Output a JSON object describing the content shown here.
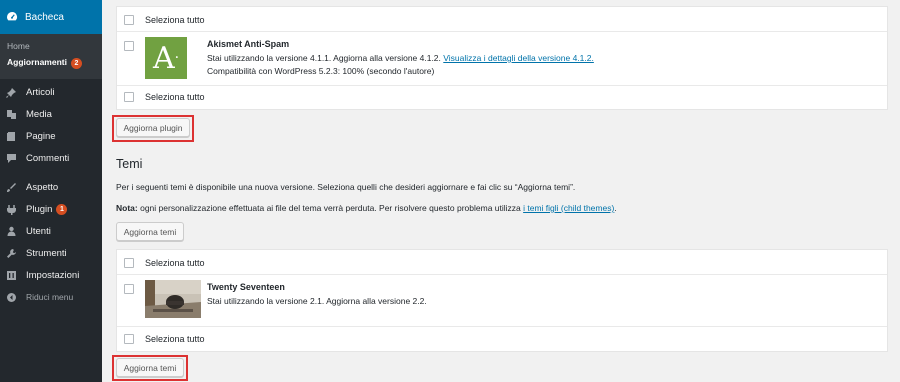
{
  "sidebar": {
    "dashboard": "Bacheca",
    "sub": {
      "home": "Home",
      "updates": "Aggiornamenti",
      "updates_count": "2"
    },
    "items": [
      {
        "label": "Articoli",
        "icon": "pin-icon"
      },
      {
        "label": "Media",
        "icon": "media-icon"
      },
      {
        "label": "Pagine",
        "icon": "pages-icon"
      },
      {
        "label": "Commenti",
        "icon": "comments-icon"
      },
      {
        "label": "Aspetto",
        "icon": "appearance-icon"
      },
      {
        "label": "Plugin",
        "icon": "plugin-icon",
        "badge": "1"
      },
      {
        "label": "Utenti",
        "icon": "users-icon"
      },
      {
        "label": "Strumenti",
        "icon": "tools-icon"
      },
      {
        "label": "Impostazioni",
        "icon": "settings-icon"
      }
    ],
    "collapse": "Riduci menu"
  },
  "plugins": {
    "select_all_top": "Seleziona tutto",
    "select_all_bottom": "Seleziona tutto",
    "item": {
      "name": "Akismet Anti-Spam",
      "desc": "Stai utilizzando la versione 4.1.1. Aggiorna alla versione 4.1.2.",
      "link": "Visualizza i dettagli della versione 4.1.2.",
      "compat": "Compatibilità con WordPress 5.2.3: 100% (secondo l'autore)"
    },
    "button": "Aggiorna plugin"
  },
  "themes": {
    "heading": "Temi",
    "intro": "Per i seguenti temi è disponibile una nuova versione. Seleziona quelli che desideri aggiornare e fai clic su “Aggiorna temi”.",
    "note_label": "Nota:",
    "note_text": " ogni personalizzazione effettuata ai file del tema verrà perduta. Per risolvere questo problema utilizza ",
    "note_link": "i temi figli (child themes)",
    "note_end": ".",
    "button_top": "Aggiorna temi",
    "select_all_top": "Seleziona tutto",
    "select_all_bottom": "Seleziona tutto",
    "item": {
      "name": "Twenty Seventeen",
      "desc": "Stai utilizzando la versione 2.1. Aggiorna alla versione 2.2."
    },
    "button_bottom": "Aggiorna temi"
  },
  "colors": {
    "sidebar": "#23282d",
    "active": "#0073aa",
    "badge": "#d54e21",
    "highlight": "#dc3232",
    "akismet": "#71a141"
  }
}
